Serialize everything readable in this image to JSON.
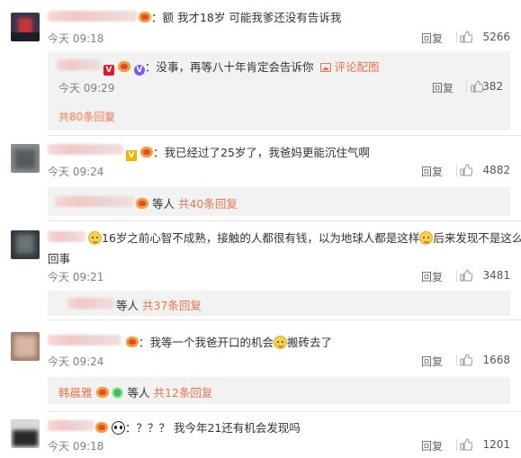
{
  "comments": [
    {
      "text": "：额 我才18岁 可能我爹还没有告诉我",
      "time": "今天 09:18",
      "reply_label": "回复",
      "likes": "5266",
      "sub": {
        "text": "：没事，再等八十年肯定会告诉你",
        "pic_link": "评论配图",
        "time": "今天 09:29",
        "reply_label": "回复",
        "likes": "382",
        "more": "共80条回复"
      }
    },
    {
      "text": "：我已经过了25岁了，我爸妈更能沉住气啊",
      "time": "今天 09:24",
      "reply_label": "回复",
      "likes": "4882",
      "sub_summary": {
        "etc": "等人",
        "more": "共40条回复"
      }
    },
    {
      "text_a": "16岁之前心智不成熟，接触的人都很有钱，以为地球人都是这样",
      "text_b": "后来发现不是这么",
      "text_c": "回事",
      "time": "今天 09:21",
      "reply_label": "回复",
      "likes": "3481",
      "sub_summary": {
        "etc": "等人",
        "more": "共37条回复"
      }
    },
    {
      "text_a": "：我等一个我爸开口的机会",
      "text_b": "搬砖去了",
      "time": "今天 09:24",
      "reply_label": "回复",
      "likes": "1668",
      "sub_summary": {
        "name": "韩晨雅",
        "etc": "等人",
        "more": "共12条回复"
      }
    },
    {
      "text": "：？？？ 我今年21还有机会发现吗",
      "time": "今天 09:18",
      "reply_label": "回复",
      "likes": "1201"
    }
  ],
  "colors": {
    "accent": "#eb7350",
    "meta": "#808080",
    "sub_bg": "#f2f2f2"
  }
}
